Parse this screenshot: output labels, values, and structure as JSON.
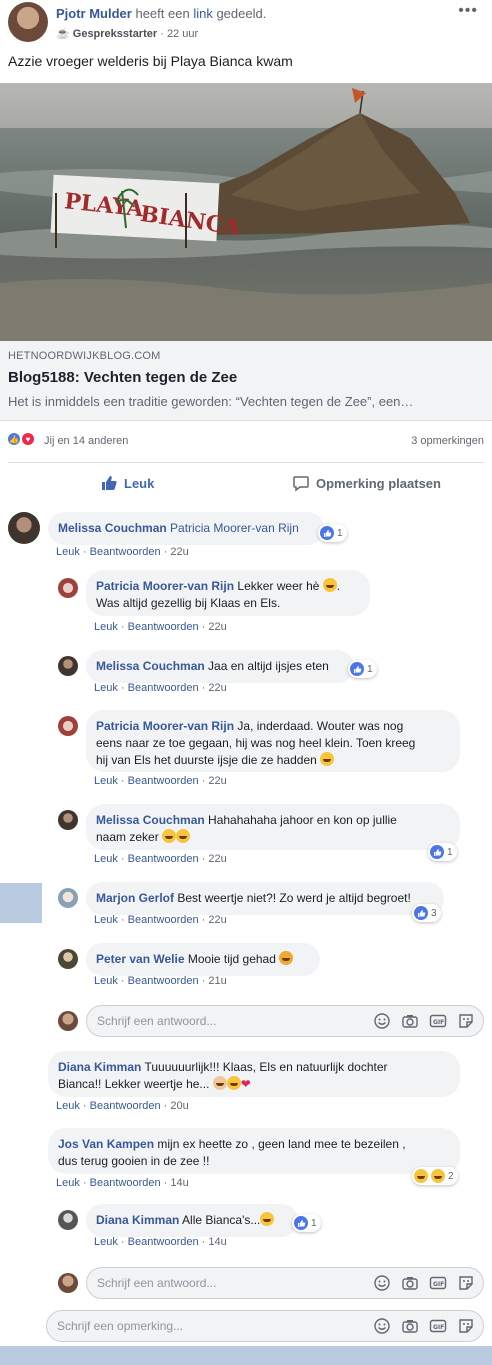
{
  "post": {
    "author": "Pjotr Mulder",
    "shared_text": "heeft een",
    "link_word": "link",
    "shared_suffix": "gedeeld.",
    "badge_label": "Gespreksstarter",
    "time": "22 uur",
    "text": "Azzie vroeger welderis bij Playa Bianca kwam",
    "photo_sign": "PLAYA BIANCA"
  },
  "link_preview": {
    "domain": "HETNOORDWIJKBLOG.COM",
    "title": "Blog5188: Vechten tegen de Zee",
    "description": "Het is inmiddels een traditie geworden: “Vechten tegen de Zee”, een…"
  },
  "stats": {
    "reactions": "Jij en 14 anderen",
    "comments": "3 opmerkingen"
  },
  "actions": {
    "like": "Leuk",
    "comment": "Opmerking plaatsen"
  },
  "labels": {
    "like": "Leuk",
    "reply": "Beantwoorden",
    "write_reply": "Schrijf een antwoord...",
    "write_comment": "Schrijf een opmerking..."
  },
  "comments": [
    {
      "name": "Melissa Couchman",
      "text": "Patricia Moorer-van Rijn",
      "time": "22u",
      "reactions": "1"
    },
    {
      "name": "Patricia Moorer-van Rijn",
      "text": "Lekker weer hè",
      "text2": "Was altijd gezellig bij Klaas en Els.",
      "time": "22u"
    },
    {
      "name": "Melissa Couchman",
      "text": "Jaa en altijd ijsjes eten",
      "time": "22u",
      "reactions": "1"
    },
    {
      "name": "Patricia Moorer-van Rijn",
      "text": "Ja, inderdaad. Wouter was nog",
      "text2": "eens naar ze toe gegaan, hij was nog heel klein. Toen kreeg",
      "text3": "hij van Els het duurste ijsje die ze hadden",
      "time": "22u"
    },
    {
      "name": "Melissa Couchman",
      "text": "Hahahahaha jahoor en kon op jullie",
      "text2": "naam zeker",
      "time": "22u",
      "reactions": "1"
    },
    {
      "name": "Marjon Gerlof",
      "text": "Best weertje niet?! Zo werd je altijd begroet!",
      "time": "22u",
      "reactions": "3"
    },
    {
      "name": "Peter van Welie",
      "text": "Mooie tijd gehad",
      "time": "21u"
    },
    {
      "name": "Diana Kimman",
      "text": "Tuuuuuurlijk!!! Klaas, Els en natuurlijk dochter",
      "text2": "Bianca!! Lekker weertje he...",
      "time": "20u"
    },
    {
      "name": "Jos Van Kampen",
      "text": "mijn ex heette zo , geen land mee te bezeilen ,",
      "text2": "dus terug gooien in de zee !!",
      "time": "14u",
      "reactions": "2"
    },
    {
      "name": "Diana Kimman",
      "text": "Alle Bianca's...",
      "time": "14u",
      "reactions": "1"
    }
  ],
  "colors": {
    "brand": "#4267b2",
    "name": "#385898",
    "bubble": "#f2f3f5"
  }
}
